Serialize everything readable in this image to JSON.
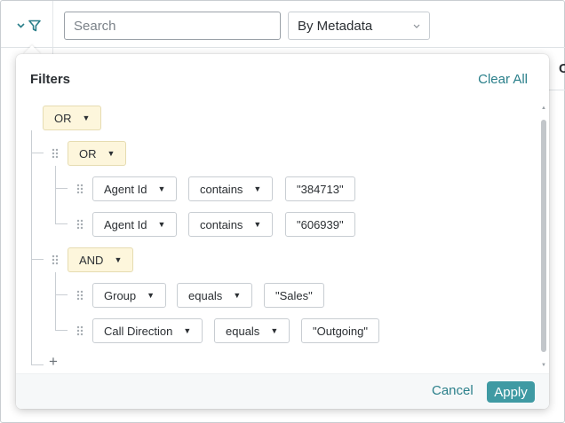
{
  "toolbar": {
    "search_placeholder": "Search",
    "metadata_select": "By Metadata",
    "background_column_header": "C"
  },
  "panel": {
    "title": "Filters",
    "clear_all": "Clear All",
    "root_operator": "OR",
    "groups": [
      {
        "operator": "OR",
        "conditions": [
          {
            "field": "Agent Id",
            "op": "contains",
            "value": "\"384713\""
          },
          {
            "field": "Agent Id",
            "op": "contains",
            "value": "\"606939\""
          }
        ]
      },
      {
        "operator": "AND",
        "conditions": [
          {
            "field": "Group",
            "op": "equals",
            "value": "\"Sales\""
          },
          {
            "field": "Call Direction",
            "op": "equals",
            "value": "\"Outgoing\""
          }
        ]
      }
    ],
    "add_label": "+",
    "cancel": "Cancel",
    "apply": "Apply"
  },
  "colors": {
    "accent": "#2a7f8a",
    "apply_bg": "#3f9aa3",
    "group_chip_bg": "#fdf6dc"
  },
  "icons": {
    "filter": "funnel-icon",
    "chevron": "chevron-down-icon",
    "handle": "drag-handle-icon"
  }
}
